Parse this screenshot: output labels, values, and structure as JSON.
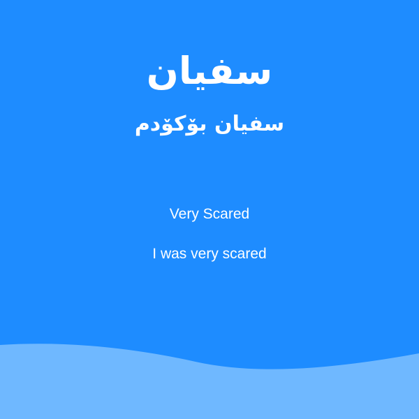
{
  "card": {
    "word": "سفيان",
    "phrase": "سفيان بۆكۆدم",
    "meaning": "Very Scared",
    "example": "I was very scared"
  },
  "colors": {
    "background": "#1e8cff",
    "wave": "#6fb8ff",
    "text": "#ffffff"
  }
}
